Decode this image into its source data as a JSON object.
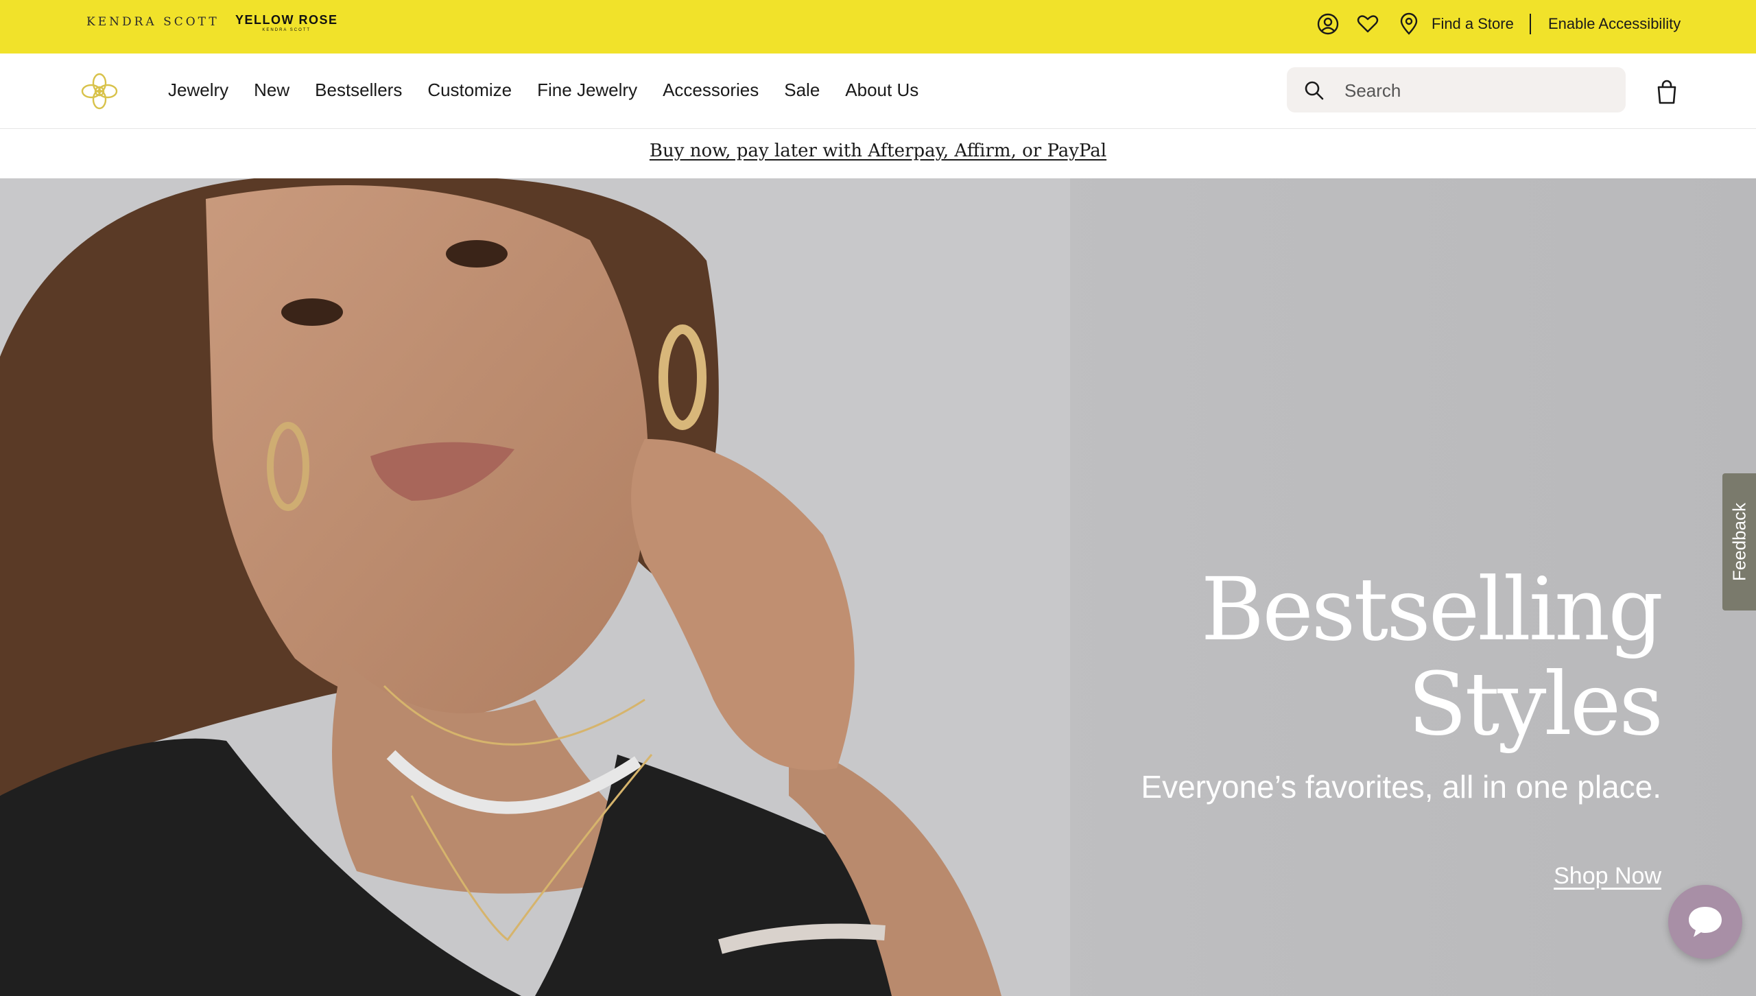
{
  "utility": {
    "brand_kendra": "KENDRA SCOTT",
    "brand_yellow_rose": "YELLOW ROSE",
    "brand_yellow_rose_sub": "KENDRA SCOTT",
    "find_store": "Find a Store",
    "accessibility": "Enable Accessibility",
    "icons": [
      "account-icon",
      "heart-icon",
      "location-pin-icon"
    ]
  },
  "nav": {
    "items": [
      "Jewelry",
      "New",
      "Bestsellers",
      "Customize",
      "Fine Jewelry",
      "Accessories",
      "Sale",
      "About Us"
    ],
    "search_placeholder": "Search"
  },
  "promo": {
    "text": "Buy now, pay later with Afterpay, Affirm, or PayPal"
  },
  "hero": {
    "title_line1": "Bestselling",
    "title_line2": "Styles",
    "subtitle": "Everyone’s favorites, all in one place.",
    "cta": "Shop Now"
  },
  "feedback": {
    "label": "Feedback"
  },
  "colors": {
    "utility_bar": "#f1e22a",
    "logo_gold": "#d8c24a",
    "chat_button": "#a88fa6",
    "feedback_tab": "#7a7a6c"
  }
}
